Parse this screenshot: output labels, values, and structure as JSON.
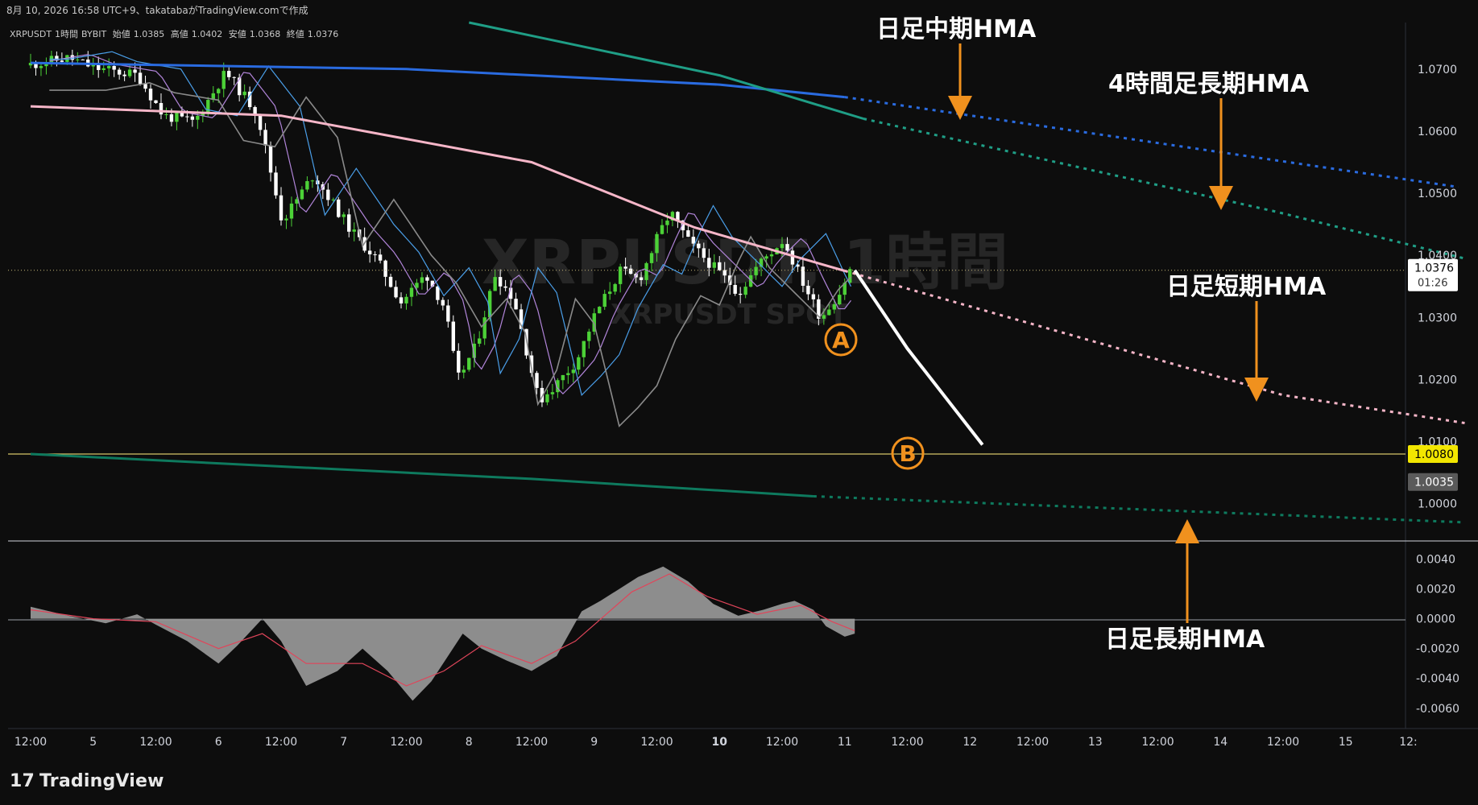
{
  "header": {
    "title": "8月 10, 2026 16:58 UTC+9、takatabaがTradingView.comで作成"
  },
  "legend": {
    "symbol": "XRPUSDT",
    "timeframe": "1時間",
    "exchange": "BYBIT",
    "open_label": "始値",
    "open": "1.0385",
    "high_label": "高値",
    "high": "1.0402",
    "low_label": "安値",
    "low": "1.0368",
    "close_label": "終値",
    "close": "1.0376"
  },
  "watermark": {
    "main": "XRPUSDT, 1時間",
    "sub": "XRPUSDT SPOT"
  },
  "price_axis": {
    "ticks": [
      "1.0700",
      "1.0600",
      "1.0500",
      "1.0400",
      "1.0300",
      "1.0200",
      "1.0100",
      "1.0000"
    ],
    "current_price": "1.0376",
    "countdown": "01:26",
    "support_label": "1.0080",
    "low_label": "1.0035"
  },
  "osc_axis": {
    "ticks": [
      "0.0040",
      "0.0020",
      "0.0000",
      "-0.0020",
      "-0.0040",
      "-0.0060"
    ]
  },
  "time_axis": {
    "labels": [
      "12:00",
      "5",
      "12:00",
      "6",
      "12:00",
      "7",
      "12:00",
      "8",
      "12:00",
      "9",
      "12:00",
      "10",
      "12:00",
      "11",
      "12:00",
      "12",
      "12:00",
      "13",
      "12:00",
      "14",
      "12:00",
      "15",
      "12:"
    ]
  },
  "annotations": {
    "daily_mid_hma": "日足中期HMA",
    "h4_long_hma": "4時間足長期HMA",
    "daily_short_hma": "日足短期HMA",
    "daily_long_hma": "日足長期HMA",
    "point_a": "A",
    "point_b": "B"
  },
  "colors": {
    "background": "#0d0d0d",
    "up_candle": "#4cd137",
    "down_candle": "#ffffff",
    "daily_mid_hma": "#2a6be0",
    "h4_long_hma": "#1f9e86",
    "daily_short_hma": "#f6b6c8",
    "daily_long_hma": "#0e7a5e",
    "annotation_arrow": "#f0911e",
    "support_line": "#d6c56a"
  },
  "footer": {
    "logo_text": "TradingView"
  },
  "chart_data": {
    "type": "candlestick",
    "symbol": "XRPUSDT",
    "timeframe": "1時間",
    "ohlc_last": {
      "open": 1.0385,
      "high": 1.0402,
      "low": 1.0368,
      "close": 1.0376
    },
    "price_range": [
      0.994,
      1.0775
    ],
    "oscillator_range": [
      -0.0072,
      0.005
    ],
    "x_range": [
      "4 12:00",
      "15 12:00"
    ],
    "price_path": [
      {
        "t": 0.0,
        "p": 1.0706
      },
      {
        "t": 0.35,
        "p": 1.0718
      },
      {
        "t": 0.55,
        "p": 1.0702
      },
      {
        "t": 0.9,
        "p": 1.069
      },
      {
        "t": 1.1,
        "p": 1.0625
      },
      {
        "t": 1.35,
        "p": 1.0615
      },
      {
        "t": 1.6,
        "p": 1.0695
      },
      {
        "t": 1.85,
        "p": 1.063
      },
      {
        "t": 2.05,
        "p": 1.0455
      },
      {
        "t": 2.3,
        "p": 1.053
      },
      {
        "t": 2.6,
        "p": 1.044
      },
      {
        "t": 2.8,
        "p": 1.0395
      },
      {
        "t": 3.0,
        "p": 1.0325
      },
      {
        "t": 3.2,
        "p": 1.037
      },
      {
        "t": 3.35,
        "p": 1.0315
      },
      {
        "t": 3.45,
        "p": 1.02
      },
      {
        "t": 3.6,
        "p": 1.0255
      },
      {
        "t": 3.75,
        "p": 1.037
      },
      {
        "t": 3.9,
        "p": 1.033
      },
      {
        "t": 4.1,
        "p": 1.0165
      },
      {
        "t": 4.25,
        "p": 1.0195
      },
      {
        "t": 4.4,
        "p": 1.023
      },
      {
        "t": 4.55,
        "p": 1.0305
      },
      {
        "t": 4.75,
        "p": 1.0375
      },
      {
        "t": 4.9,
        "p": 1.036
      },
      {
        "t": 5.05,
        "p": 1.043
      },
      {
        "t": 5.15,
        "p": 1.047
      },
      {
        "t": 5.3,
        "p": 1.042
      },
      {
        "t": 5.5,
        "p": 1.038
      },
      {
        "t": 5.7,
        "p": 1.034
      },
      {
        "t": 5.85,
        "p": 1.0385
      },
      {
        "t": 6.05,
        "p": 1.0425
      },
      {
        "t": 6.2,
        "p": 1.036
      },
      {
        "t": 6.35,
        "p": 1.03
      },
      {
        "t": 6.5,
        "p": 1.034
      },
      {
        "t": 6.58,
        "p": 1.0376
      }
    ],
    "series": [
      {
        "name": "日足中期HMA",
        "points": [
          [
            0.0,
            1.071
          ],
          [
            3.0,
            1.07
          ],
          [
            5.5,
            1.0675
          ],
          [
            6.5,
            1.0655
          ]
        ],
        "projection": [
          [
            6.5,
            1.0655
          ],
          [
            11.4,
            1.051
          ]
        ]
      },
      {
        "name": "4時間足長期HMA",
        "points": [
          [
            3.5,
            1.0775
          ],
          [
            5.5,
            1.069
          ],
          [
            6.65,
            1.062
          ]
        ],
        "projection": [
          [
            6.65,
            1.062
          ],
          [
            9.95,
            1.047
          ],
          [
            11.45,
            1.0395
          ]
        ]
      },
      {
        "name": "日足短期HMA",
        "points": [
          [
            0.0,
            1.064
          ],
          [
            2.0,
            1.0625
          ],
          [
            4.0,
            1.055
          ],
          [
            5.3,
            1.0445
          ],
          [
            6.5,
            1.0375
          ]
        ],
        "projection": [
          [
            6.5,
            1.0375
          ],
          [
            10.0,
            1.0175
          ],
          [
            11.45,
            1.013
          ]
        ]
      },
      {
        "name": "日足長期HMA",
        "points": [
          [
            0.0,
            1.008
          ],
          [
            4.0,
            1.004
          ],
          [
            6.25,
            1.0012
          ]
        ],
        "projection": [
          [
            6.25,
            1.0012
          ],
          [
            11.45,
            0.997
          ]
        ]
      }
    ],
    "forecast_path": [
      [
        6.58,
        1.0376
      ],
      [
        7.0,
        1.025
      ],
      [
        7.6,
        1.0095
      ]
    ],
    "support_level": 1.008,
    "oscillator": {
      "values": [
        [
          0.0,
          0.0008
        ],
        [
          0.3,
          0.0002
        ],
        [
          0.6,
          -0.0003
        ],
        [
          0.85,
          0.0003
        ],
        [
          1.0,
          -0.0004
        ],
        [
          1.25,
          -0.0015
        ],
        [
          1.5,
          -0.003
        ],
        [
          1.65,
          -0.0018
        ],
        [
          1.85,
          0.0
        ],
        [
          2.0,
          -0.0015
        ],
        [
          2.2,
          -0.0045
        ],
        [
          2.45,
          -0.0035
        ],
        [
          2.65,
          -0.002
        ],
        [
          2.85,
          -0.0035
        ],
        [
          3.05,
          -0.0055
        ],
        [
          3.2,
          -0.0042
        ],
        [
          3.45,
          -0.001
        ],
        [
          3.6,
          -0.002
        ],
        [
          3.8,
          -0.0028
        ],
        [
          4.0,
          -0.0035
        ],
        [
          4.2,
          -0.0025
        ],
        [
          4.4,
          0.0005
        ],
        [
          4.55,
          0.0012
        ],
        [
          4.85,
          0.0028
        ],
        [
          5.05,
          0.0035
        ],
        [
          5.25,
          0.0025
        ],
        [
          5.45,
          0.001
        ],
        [
          5.65,
          0.0002
        ],
        [
          5.85,
          0.0006
        ],
        [
          6.0,
          0.001
        ],
        [
          6.1,
          0.0012
        ],
        [
          6.25,
          0.0006
        ],
        [
          6.35,
          -0.0005
        ],
        [
          6.5,
          -0.0012
        ],
        [
          6.58,
          -0.001
        ]
      ],
      "signal": [
        [
          0.0,
          0.0006
        ],
        [
          0.5,
          0.0
        ],
        [
          1.0,
          -0.0002
        ],
        [
          1.5,
          -0.002
        ],
        [
          1.85,
          -0.001
        ],
        [
          2.2,
          -0.003
        ],
        [
          2.65,
          -0.003
        ],
        [
          3.0,
          -0.0045
        ],
        [
          3.3,
          -0.0035
        ],
        [
          3.6,
          -0.0018
        ],
        [
          4.0,
          -0.003
        ],
        [
          4.35,
          -0.0015
        ],
        [
          4.8,
          0.0018
        ],
        [
          5.1,
          0.003
        ],
        [
          5.4,
          0.0015
        ],
        [
          5.8,
          0.0003
        ],
        [
          6.15,
          0.0009
        ],
        [
          6.4,
          -0.0002
        ],
        [
          6.58,
          -0.0008
        ]
      ]
    }
  }
}
